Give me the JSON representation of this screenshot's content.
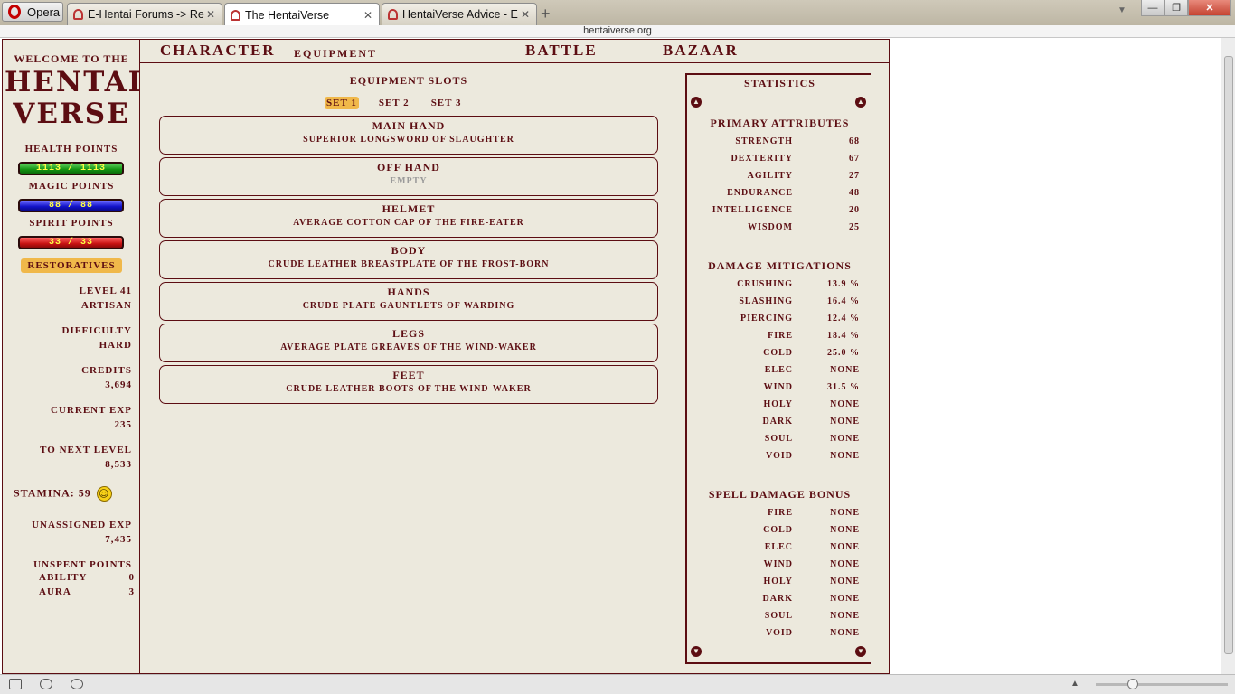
{
  "browser": {
    "opera_label": "Opera",
    "tabs": [
      {
        "label": "E-Hentai Forums -> Re..."
      },
      {
        "label": "The HentaiVerse"
      },
      {
        "label": "HentaiVerse Advice - E..."
      }
    ],
    "new_tab_symbol": "+",
    "close_symbol": "✕",
    "url": "hentaiverse.org",
    "window_buttons": {
      "minimize": "—",
      "maximize": "❐",
      "close": "✕"
    }
  },
  "left": {
    "welcome": "Welcome to the",
    "logo_line1": "HENTAI",
    "logo_line2": "VERSE",
    "health_label": "Health points",
    "health_value": "1113 / 1113",
    "magic_label": "Magic points",
    "magic_value": "88 / 88",
    "spirit_label": "Spirit points",
    "spirit_value": "33 / 33",
    "restoratives": "Restoratives",
    "level": "Level 41",
    "title": "Artisan",
    "difficulty_label": "Difficulty",
    "difficulty": "Hard",
    "credits_label": "Credits",
    "credits": "3,694",
    "current_exp_label": "Current EXP",
    "current_exp": "235",
    "next_level_label": "To Next Level",
    "next_level": "8,533",
    "stamina": "Stamina: 59",
    "unassigned_label": "Unassigned EXP",
    "unassigned": "7,435",
    "unspent_label": "Unspent Points",
    "ability_label": "Ability",
    "ability": "0",
    "aura_label": "Aura",
    "aura": "3"
  },
  "nav": {
    "character": "Character",
    "equipment": "Equipment",
    "battle": "Battle",
    "bazaar": "Bazaar"
  },
  "equipment": {
    "title": "Equipment Slots",
    "sets": [
      "Set 1",
      "Set 2",
      "Set 3"
    ],
    "slots": [
      {
        "name": "Main Hand",
        "item": "Superior Longsword of Slaughter"
      },
      {
        "name": "Off Hand",
        "item": "Empty"
      },
      {
        "name": "Helmet",
        "item": "Average Cotton Cap of the Fire-eater"
      },
      {
        "name": "Body",
        "item": "Crude Leather Breastplate of the Frost-born"
      },
      {
        "name": "Hands",
        "item": "Crude Plate Gauntlets of Warding"
      },
      {
        "name": "Legs",
        "item": "Average Plate Greaves of the Wind-waker"
      },
      {
        "name": "Feet",
        "item": "Crude Leather Boots of the Wind-waker"
      }
    ]
  },
  "statistics": {
    "title": "Statistics",
    "primary_title": "Primary Attributes",
    "primary": [
      {
        "k": "Strength",
        "v": "68"
      },
      {
        "k": "Dexterity",
        "v": "67"
      },
      {
        "k": "Agility",
        "v": "27"
      },
      {
        "k": "Endurance",
        "v": "48"
      },
      {
        "k": "Intelligence",
        "v": "20"
      },
      {
        "k": "Wisdom",
        "v": "25"
      }
    ],
    "mitigation_title": "Damage Mitigations",
    "mitigation": [
      {
        "k": "Crushing",
        "v": "13.9 %"
      },
      {
        "k": "Slashing",
        "v": "16.4 %"
      },
      {
        "k": "Piercing",
        "v": "12.4 %"
      },
      {
        "k": "Fire",
        "v": "18.4 %"
      },
      {
        "k": "Cold",
        "v": "25.0 %"
      },
      {
        "k": "Elec",
        "v": "None"
      },
      {
        "k": "Wind",
        "v": "31.5 %"
      },
      {
        "k": "Holy",
        "v": "None"
      },
      {
        "k": "Dark",
        "v": "None"
      },
      {
        "k": "Soul",
        "v": "None"
      },
      {
        "k": "Void",
        "v": "None"
      }
    ],
    "spell_title": "Spell Damage Bonus",
    "spell": [
      {
        "k": "Fire",
        "v": "None"
      },
      {
        "k": "Cold",
        "v": "None"
      },
      {
        "k": "Elec",
        "v": "None"
      },
      {
        "k": "Wind",
        "v": "None"
      },
      {
        "k": "Holy",
        "v": "None"
      },
      {
        "k": "Dark",
        "v": "None"
      },
      {
        "k": "Soul",
        "v": "None"
      },
      {
        "k": "Void",
        "v": "None"
      }
    ]
  },
  "colors": {
    "primary": "#5c0d12",
    "background": "#ece9dd",
    "highlight": "#f0b84a"
  }
}
